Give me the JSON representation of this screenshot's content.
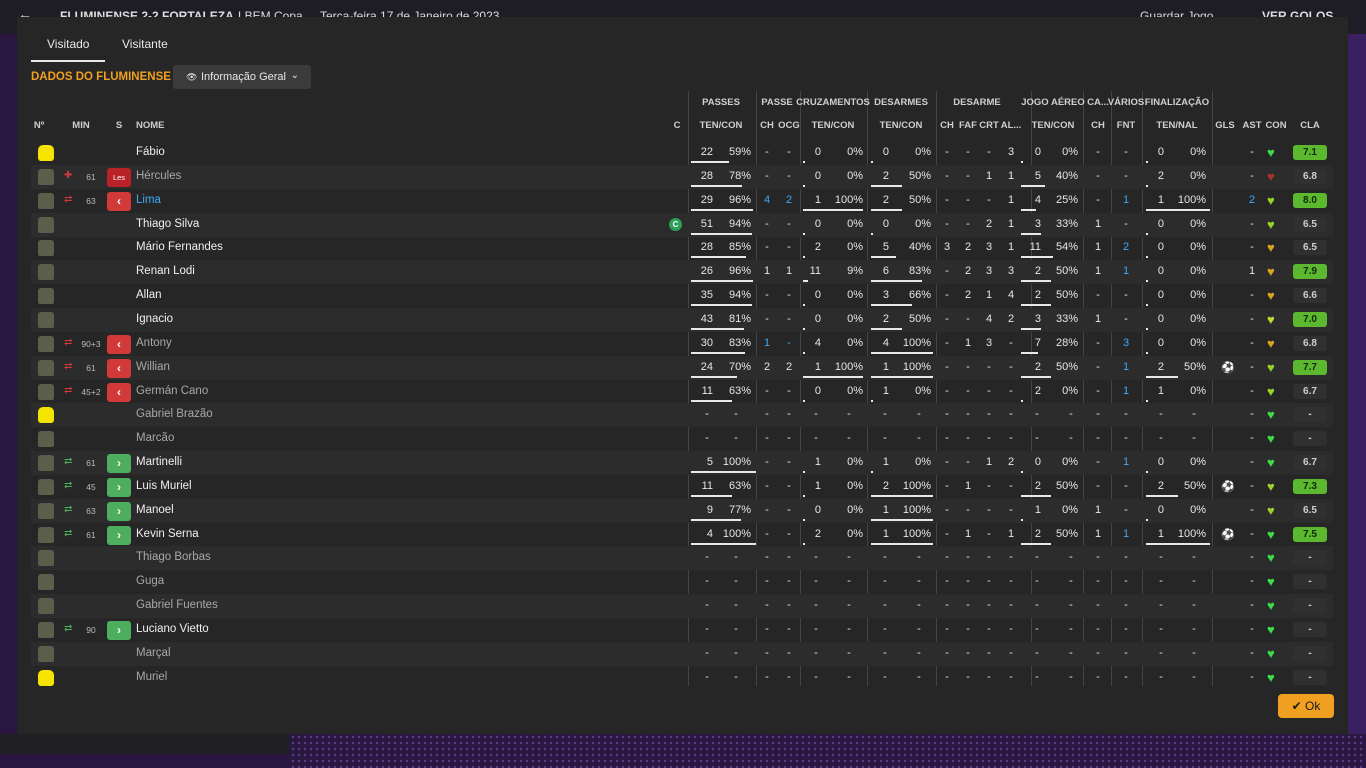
{
  "background": {
    "match_title": "FLUMINENSE 2-2 FORTALEZA",
    "competition": "LBEM Copa",
    "date": "Terça-feira 17 de Janeiro de 2023",
    "save_label": "Guardar Jogo",
    "goals_label": "VER GOLOS"
  },
  "tabs": [
    "Visitado",
    "Visitante"
  ],
  "section_title": "DADOS DO FLUMINENSE",
  "view_selector": "Informação Geral",
  "group_headers": {
    "passes": "PASSES",
    "passe": "PASSE",
    "crossings": "CRUZAMENTOS",
    "tackles": "DESARMES",
    "dispossess": "DESARME",
    "aerial": "JOGO AÉREO",
    "ca": "CA...",
    "various": "VÁRIOS",
    "finishing": "FINALIZAÇÃO"
  },
  "columns": {
    "num": "Nº",
    "min": "MIN",
    "s": "S",
    "name": "NOME",
    "c": "C",
    "passes_tc": "TEN/CON",
    "ch": "CH",
    "ocg": "OCG",
    "cross_tc": "TEN/CON",
    "tackle_tc": "TEN/CON",
    "d_ch": "CH",
    "faf": "FAF",
    "crt": "CRT",
    "al": "AL...",
    "aerial_tc": "TEN/CON",
    "ca_ch": "CH",
    "fnt": "FNT",
    "fin_tn": "TEN/NAL",
    "gls": "GLS",
    "ast": "AST",
    "con": "CON",
    "cla": "CLA"
  },
  "captain_badge": "C",
  "players": [
    {
      "name": "Fábio",
      "gk": true,
      "min": "",
      "sub": "",
      "p": [
        "22",
        "59%"
      ],
      "pb": 0.59,
      "ch": "-",
      "ocg": "-",
      "cr": [
        "0",
        "0%"
      ],
      "crb": 0,
      "ta": [
        "0",
        "0%"
      ],
      "tab": 0,
      "dch": "-",
      "faf": "-",
      "crt": "-",
      "al": "3",
      "ae": [
        "0",
        "0%"
      ],
      "aeb": 0,
      "cach": "-",
      "fnt": "-",
      "fi": [
        "0",
        "0%"
      ],
      "fib": 0,
      "gls": "",
      "ast": "-",
      "cla": "7.1",
      "good": true,
      "heart": "#3ddc4a"
    },
    {
      "name": "Hércules",
      "dim": true,
      "min": "61",
      "sub": "inj",
      "sub_label": "Les",
      "injury": true,
      "p": [
        "28",
        "78%"
      ],
      "pb": 0.78,
      "ch": "-",
      "ocg": "-",
      "cr": [
        "0",
        "0%"
      ],
      "crb": 0,
      "ta": [
        "2",
        "50%"
      ],
      "tab": 0.5,
      "dch": "-",
      "faf": "-",
      "crt": "1",
      "al": "1",
      "ae": [
        "5",
        "40%"
      ],
      "aeb": 0.4,
      "cach": "-",
      "fnt": "-",
      "fi": [
        "2",
        "0%"
      ],
      "fib": 0,
      "gls": "",
      "ast": "-",
      "cla": "6.8",
      "good": false,
      "heart": "#b0302a"
    },
    {
      "name": "Lima",
      "blue": true,
      "min": "63",
      "sub": "out",
      "p": [
        "29",
        "96%"
      ],
      "pb": 0.96,
      "ch": "4",
      "ocg": "2",
      "chblue": true,
      "cr": [
        "1",
        "100%"
      ],
      "crb": 1,
      "ta": [
        "2",
        "50%"
      ],
      "tab": 0.5,
      "dch": "-",
      "faf": "-",
      "crt": "-",
      "al": "1",
      "ae": [
        "4",
        "25%"
      ],
      "aeb": 0.25,
      "cach": "-",
      "fnt": "1",
      "fi": [
        "1",
        "100%"
      ],
      "fib": 1,
      "gls": "",
      "ast": "2",
      "astblue": true,
      "cla": "8.0",
      "good": true,
      "heart": "#9ad42a"
    },
    {
      "name": "Thiago Silva",
      "captain": true,
      "min": "",
      "sub": "",
      "p": [
        "51",
        "94%"
      ],
      "pb": 0.94,
      "ch": "-",
      "ocg": "-",
      "cr": [
        "0",
        "0%"
      ],
      "crb": 0,
      "ta": [
        "0",
        "0%"
      ],
      "tab": 0,
      "dch": "-",
      "faf": "-",
      "crt": "2",
      "al": "1",
      "ae": [
        "3",
        "33%"
      ],
      "aeb": 0.33,
      "cach": "1",
      "fnt": "-",
      "fi": [
        "0",
        "0%"
      ],
      "fib": 0,
      "gls": "",
      "ast": "-",
      "cla": "6.5",
      "good": false,
      "heart": "#9ad42a"
    },
    {
      "name": "Mário Fernandes",
      "min": "",
      "sub": "",
      "p": [
        "28",
        "85%"
      ],
      "pb": 0.85,
      "ch": "-",
      "ocg": "-",
      "cr": [
        "2",
        "0%"
      ],
      "crb": 0,
      "ta": [
        "5",
        "40%"
      ],
      "tab": 0.4,
      "dch": "3",
      "faf": "2",
      "crt": "3",
      "al": "1",
      "ae": [
        "11",
        "54%"
      ],
      "aeb": 0.54,
      "cach": "1",
      "fnt": "2",
      "fi": [
        "0",
        "0%"
      ],
      "fib": 0,
      "gls": "",
      "ast": "-",
      "cla": "6.5",
      "good": false,
      "heart": "#e0a020"
    },
    {
      "name": "Renan Lodi",
      "min": "",
      "sub": "",
      "p": [
        "26",
        "96%"
      ],
      "pb": 0.96,
      "ch": "1",
      "ocg": "1",
      "cr": [
        "11",
        "9%"
      ],
      "crb": 0.09,
      "ta": [
        "6",
        "83%"
      ],
      "tab": 0.83,
      "dch": "-",
      "faf": "2",
      "crt": "3",
      "al": "3",
      "ae": [
        "2",
        "50%"
      ],
      "aeb": 0.5,
      "cach": "1",
      "fnt": "1",
      "fi": [
        "0",
        "0%"
      ],
      "fib": 0,
      "gls": "",
      "ast": "1",
      "cla": "7.9",
      "good": true,
      "heart": "#e0a020"
    },
    {
      "name": "Allan",
      "min": "",
      "sub": "",
      "p": [
        "35",
        "94%"
      ],
      "pb": 0.94,
      "ch": "-",
      "ocg": "-",
      "cr": [
        "0",
        "0%"
      ],
      "crb": 0,
      "ta": [
        "3",
        "66%"
      ],
      "tab": 0.66,
      "dch": "-",
      "faf": "2",
      "crt": "1",
      "al": "4",
      "ae": [
        "2",
        "50%"
      ],
      "aeb": 0.5,
      "cach": "-",
      "fnt": "-",
      "fi": [
        "0",
        "0%"
      ],
      "fib": 0,
      "gls": "",
      "ast": "-",
      "cla": "6.6",
      "good": false,
      "heart": "#e0a020"
    },
    {
      "name": "Ignacio",
      "min": "",
      "sub": "",
      "p": [
        "43",
        "81%"
      ],
      "pb": 0.81,
      "ch": "-",
      "ocg": "-",
      "cr": [
        "0",
        "0%"
      ],
      "crb": 0,
      "ta": [
        "2",
        "50%"
      ],
      "tab": 0.5,
      "dch": "-",
      "faf": "-",
      "crt": "4",
      "al": "2",
      "ae": [
        "3",
        "33%"
      ],
      "aeb": 0.33,
      "cach": "1",
      "fnt": "-",
      "fi": [
        "0",
        "0%"
      ],
      "fib": 0,
      "gls": "",
      "ast": "-",
      "cla": "7.0",
      "good": true,
      "heart": "#c8d830"
    },
    {
      "name": "Antony",
      "dim": true,
      "min": "90+3",
      "sub": "out",
      "p": [
        "30",
        "83%"
      ],
      "pb": 0.83,
      "ch": "1",
      "ocg": "-",
      "chblue": true,
      "cr": [
        "4",
        "0%"
      ],
      "crb": 0,
      "ta": [
        "4",
        "100%"
      ],
      "tab": 1,
      "dch": "-",
      "faf": "1",
      "crt": "3",
      "al": "-",
      "ae": [
        "7",
        "28%"
      ],
      "aeb": 0.28,
      "cach": "-",
      "fnt": "3",
      "fi": [
        "0",
        "0%"
      ],
      "fib": 0,
      "gls": "",
      "ast": "-",
      "cla": "6.8",
      "good": false,
      "heart": "#e0a020"
    },
    {
      "name": "Willian",
      "dim": true,
      "min": "61",
      "sub": "out",
      "p": [
        "24",
        "70%"
      ],
      "pb": 0.7,
      "ch": "2",
      "ocg": "2",
      "cr": [
        "1",
        "100%"
      ],
      "crb": 1,
      "ta": [
        "1",
        "100%"
      ],
      "tab": 1,
      "dch": "-",
      "faf": "-",
      "crt": "-",
      "al": "-",
      "ae": [
        "2",
        "50%"
      ],
      "aeb": 0.5,
      "cach": "-",
      "fnt": "1",
      "fi": [
        "2",
        "50%"
      ],
      "fib": 0.5,
      "gls": "⚽",
      "ast": "-",
      "cla": "7.7",
      "good": true,
      "heart": "#9ad42a"
    },
    {
      "name": "Germán Cano",
      "dim": true,
      "min": "45+2",
      "sub": "out",
      "p": [
        "11",
        "63%"
      ],
      "pb": 0.63,
      "ch": "-",
      "ocg": "-",
      "cr": [
        "0",
        "0%"
      ],
      "crb": 0,
      "ta": [
        "1",
        "0%"
      ],
      "tab": 0,
      "dch": "-",
      "faf": "-",
      "crt": "-",
      "al": "-",
      "ae": [
        "2",
        "0%"
      ],
      "aeb": 0,
      "cach": "-",
      "fnt": "1",
      "fi": [
        "1",
        "0%"
      ],
      "fib": 0,
      "gls": "",
      "ast": "-",
      "cla": "6.7",
      "good": false,
      "heart": "#9ad42a"
    },
    {
      "name": "Gabriel Brazão",
      "dim": true,
      "gk": true,
      "empty": true,
      "heart": "#3ddc4a"
    },
    {
      "name": "Marcão",
      "dim": true,
      "empty": true,
      "heart": "#3ddc4a"
    },
    {
      "name": "Martinelli",
      "min": "61",
      "sub": "in",
      "p": [
        "5",
        "100%"
      ],
      "pb": 1,
      "ch": "-",
      "ocg": "-",
      "cr": [
        "1",
        "0%"
      ],
      "crb": 0,
      "ta": [
        "1",
        "0%"
      ],
      "tab": 0,
      "dch": "-",
      "faf": "-",
      "crt": "1",
      "al": "2",
      "ae": [
        "0",
        "0%"
      ],
      "aeb": 0,
      "cach": "-",
      "fnt": "1",
      "fi": [
        "0",
        "0%"
      ],
      "fib": 0,
      "gls": "",
      "ast": "-",
      "cla": "6.7",
      "good": false,
      "heart": "#3ddc4a"
    },
    {
      "name": "Luis Muriel",
      "min": "45",
      "sub": "in",
      "p": [
        "11",
        "63%"
      ],
      "pb": 0.63,
      "ch": "-",
      "ocg": "-",
      "cr": [
        "1",
        "0%"
      ],
      "crb": 0,
      "ta": [
        "2",
        "100%"
      ],
      "tab": 1,
      "dch": "-",
      "faf": "1",
      "crt": "-",
      "al": "-",
      "ae": [
        "2",
        "50%"
      ],
      "aeb": 0.5,
      "cach": "-",
      "fnt": "-",
      "fi": [
        "2",
        "50%"
      ],
      "fib": 0.5,
      "gls": "⚽",
      "ast": "-",
      "cla": "7.3",
      "good": true,
      "heart": "#9ad42a"
    },
    {
      "name": "Manoel",
      "min": "63",
      "sub": "in",
      "p": [
        "9",
        "77%"
      ],
      "pb": 0.77,
      "ch": "-",
      "ocg": "-",
      "cr": [
        "0",
        "0%"
      ],
      "crb": 0,
      "ta": [
        "1",
        "100%"
      ],
      "tab": 1,
      "dch": "-",
      "faf": "-",
      "crt": "-",
      "al": "-",
      "ae": [
        "1",
        "0%"
      ],
      "aeb": 0,
      "cach": "1",
      "fnt": "-",
      "fi": [
        "0",
        "0%"
      ],
      "fib": 0,
      "gls": "",
      "ast": "-",
      "cla": "6.5",
      "good": false,
      "heart": "#9ad42a"
    },
    {
      "name": "Kevin Serna",
      "min": "61",
      "sub": "in",
      "p": [
        "4",
        "100%"
      ],
      "pb": 1,
      "ch": "-",
      "ocg": "-",
      "cr": [
        "2",
        "0%"
      ],
      "crb": 0,
      "ta": [
        "1",
        "100%"
      ],
      "tab": 1,
      "dch": "-",
      "faf": "1",
      "crt": "-",
      "al": "1",
      "ae": [
        "2",
        "50%"
      ],
      "aeb": 0.5,
      "cach": "1",
      "fnt": "1",
      "fi": [
        "1",
        "100%"
      ],
      "fib": 1,
      "gls": "⚽",
      "ast": "-",
      "cla": "7.5",
      "good": true,
      "heart": "#3ddc4a"
    },
    {
      "name": "Thiago Borbas",
      "dim": true,
      "empty": true,
      "heart": "#3ddc4a"
    },
    {
      "name": "Guga",
      "dim": true,
      "empty": true,
      "heart": "#3ddc4a"
    },
    {
      "name": "Gabriel Fuentes",
      "dim": true,
      "empty": true,
      "heart": "#3ddc4a"
    },
    {
      "name": "Luciano Vietto",
      "min": "90",
      "sub": "in",
      "empty": true,
      "heart": "#3ddc4a"
    },
    {
      "name": "Marçal",
      "dim": true,
      "empty": true,
      "heart": "#3ddc4a"
    },
    {
      "name": "Muriel",
      "dim": true,
      "gk": true,
      "empty": true,
      "heart": "#3ddc4a"
    }
  ],
  "ok_label": "Ok",
  "colors": {
    "accent": "#f0a020",
    "rating_good": "#5cb82e",
    "sub_in": "#4cae5e",
    "sub_out": "#d23a3a",
    "link_blue": "#3fa9f5"
  }
}
